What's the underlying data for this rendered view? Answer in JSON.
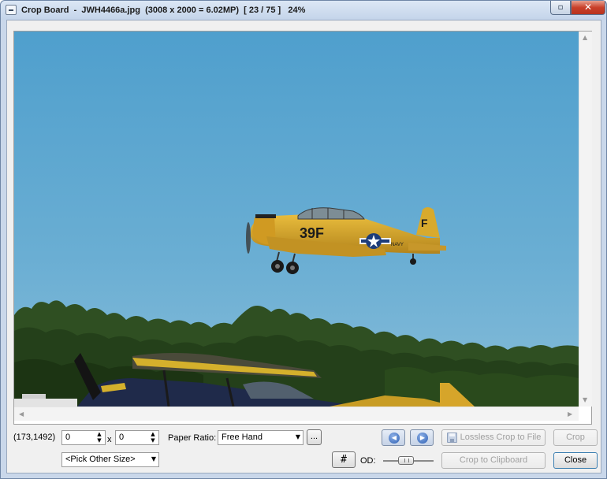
{
  "window": {
    "title": "Crop Board  -  JWH4466a.jpg  (3008 x 2000 = 6.02MP)  [ 23 / 75 ]   24%",
    "restore_glyph": "▫",
    "close_glyph": "✕"
  },
  "scrollbars": {
    "up_glyph": "▲",
    "down_glyph": "▼",
    "left_glyph": "◀",
    "right_glyph": "▶"
  },
  "controls": {
    "cursor_coords": "(173,1492)",
    "width_value": "0",
    "height_value": "0",
    "times_sign": "x",
    "paper_ratio_label": "Paper Ratio:",
    "paper_ratio_value": "Free Hand",
    "more_button": "...",
    "other_size_value": "<Pick Other Size>",
    "grid_glyph": "#",
    "od_label": "OD:",
    "prev_glyph": "◀",
    "next_glyph": "▶",
    "lossless_crop_label": "Lossless Crop to File",
    "crop_label": "Crop",
    "crop_clipboard_label": "Crop to Clipboard",
    "close_label": "Close",
    "spin_up": "▲",
    "spin_down": "▼",
    "combo_arrow": "▼"
  },
  "photo_text": {
    "fuselage_code": "39F",
    "tail_letter": "F",
    "navy_text": "NAVY"
  },
  "colors": {
    "sky": "#5fa8cf",
    "aircraft_yellow": "#d6a52a",
    "tree_green": "#2c4a1f",
    "biplane_navy": "#1f2a4a"
  }
}
